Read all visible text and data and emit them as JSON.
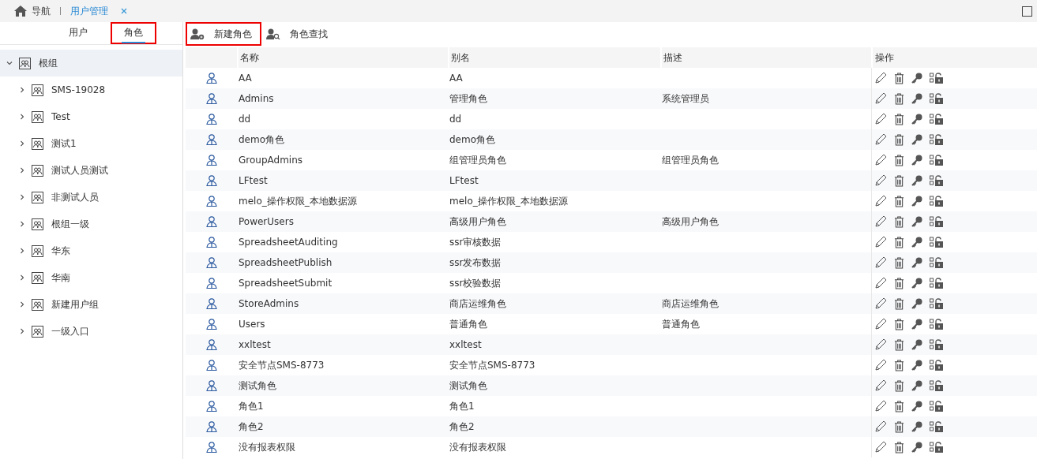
{
  "nav_tabs": [
    {
      "label": "导航",
      "kind": "home",
      "selected": false
    },
    {
      "label": "用户管理",
      "kind": "page",
      "selected": true,
      "closable": true
    }
  ],
  "sidebar": {
    "tabs": [
      {
        "label": "用户",
        "selected": false,
        "highlighted": false
      },
      {
        "label": "角色",
        "selected": true,
        "highlighted": true
      }
    ],
    "tree": [
      {
        "label": "根组",
        "expanded": true,
        "selected": true,
        "children": [
          {
            "label": "SMS-19028",
            "expanded": false,
            "selected": false
          },
          {
            "label": "Test",
            "expanded": false,
            "selected": false
          },
          {
            "label": "测试1",
            "expanded": false,
            "selected": false
          },
          {
            "label": "测试人员测试",
            "expanded": false,
            "selected": false
          },
          {
            "label": "非测试人员",
            "expanded": false,
            "selected": false
          },
          {
            "label": "根组一级",
            "expanded": false,
            "selected": false
          },
          {
            "label": "华东",
            "expanded": false,
            "selected": false
          },
          {
            "label": "华南",
            "expanded": false,
            "selected": false
          },
          {
            "label": "新建用户组",
            "expanded": false,
            "selected": false
          },
          {
            "label": "一级入口",
            "expanded": false,
            "selected": false
          }
        ]
      }
    ]
  },
  "toolbar": [
    {
      "label": "新建角色",
      "kind": "add",
      "highlighted": true
    },
    {
      "label": "角色查找",
      "kind": "search",
      "highlighted": false
    }
  ],
  "table": {
    "columns": [
      "名称",
      "别名",
      "描述",
      "操作"
    ],
    "rows": [
      {
        "name": "AA",
        "alias": "AA"
      },
      {
        "name": "Admins",
        "alias": "管理角色",
        "description": "系统管理员"
      },
      {
        "name": "dd",
        "alias": "dd"
      },
      {
        "name": "demo角色",
        "alias": "demo角色"
      },
      {
        "name": "GroupAdmins",
        "alias": "组管理员角色",
        "description": "组管理员角色"
      },
      {
        "name": "LFtest",
        "alias": "LFtest"
      },
      {
        "name": "melo_操作权限_本地数据源",
        "alias": "melo_操作权限_本地数据源"
      },
      {
        "name": "PowerUsers",
        "alias": "高级用户角色",
        "description": "高级用户角色"
      },
      {
        "name": "SpreadsheetAuditing",
        "alias": "ssr审核数据"
      },
      {
        "name": "SpreadsheetPublish",
        "alias": "ssr发布数据"
      },
      {
        "name": "SpreadsheetSubmit",
        "alias": "ssr校验数据"
      },
      {
        "name": "StoreAdmins",
        "alias": "商店运维角色",
        "description": "商店运维角色"
      },
      {
        "name": "Users",
        "alias": "普通角色",
        "description": "普通角色"
      },
      {
        "name": "xxltest",
        "alias": "xxltest"
      },
      {
        "name": "安全节点SMS-8773",
        "alias": "安全节点SMS-8773"
      },
      {
        "name": "测试角色",
        "alias": "测试角色"
      },
      {
        "name": "角色1",
        "alias": "角色1"
      },
      {
        "name": "角色2",
        "alias": "角色2"
      },
      {
        "name": "没有报表权限",
        "alias": "没有报表权限"
      }
    ]
  }
}
